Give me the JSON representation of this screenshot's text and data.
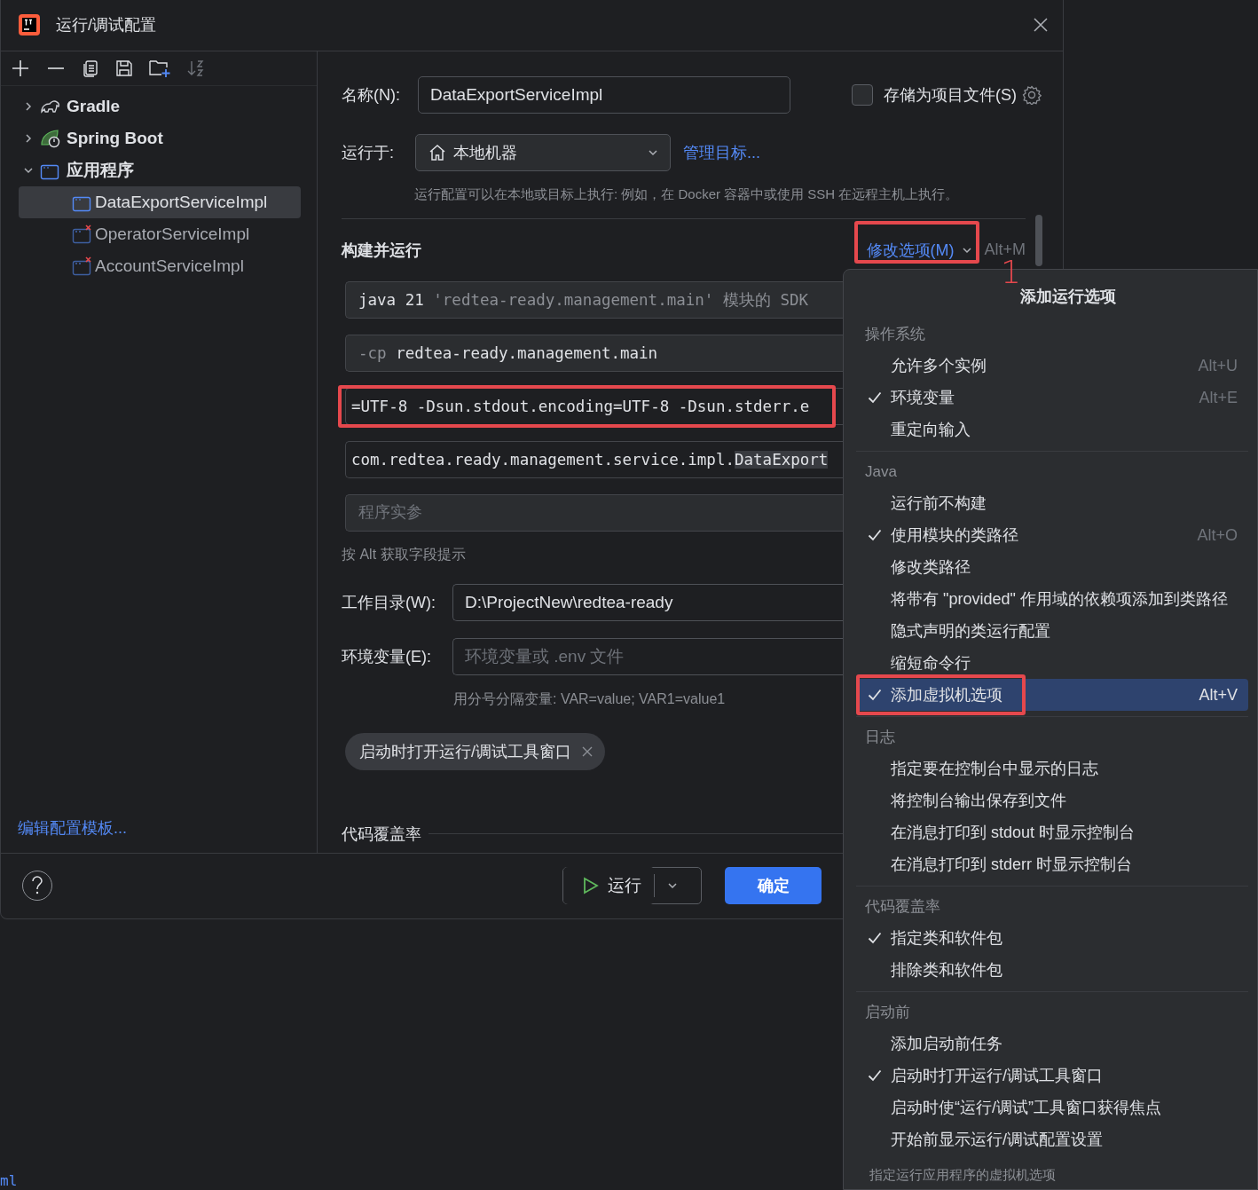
{
  "window": {
    "title": "运行/调试配置"
  },
  "sidebar": {
    "tree": [
      {
        "label": "Gradle",
        "kind": "gradle",
        "expanded": false,
        "selected": false
      },
      {
        "label": "Spring Boot",
        "kind": "spring",
        "expanded": false,
        "selected": false
      },
      {
        "label": "应用程序",
        "kind": "app",
        "expanded": true,
        "selected": false,
        "children": [
          {
            "label": "DataExportServiceImpl",
            "selected": true,
            "error": false
          },
          {
            "label": "OperatorServiceImpl",
            "selected": false,
            "error": true
          },
          {
            "label": "AccountServiceImpl",
            "selected": false,
            "error": true
          }
        ]
      }
    ],
    "template_link": "编辑配置模板..."
  },
  "form": {
    "name_label": "名称(N):",
    "name_value": "DataExportServiceImpl",
    "store_checkbox": {
      "label": "存储为项目文件(S)",
      "checked": false
    },
    "run_on_label": "运行于:",
    "run_on_value": "本地机器",
    "manage_link": "管理目标...",
    "run_on_hint": "运行配置可以在本地或目标上执行: 例如，在 Docker 容器中或使用 SSH 在远程主机上执行。",
    "section_title": "构建并运行",
    "modify_options": {
      "label": "修改选项(M)",
      "shortcut": "Alt+M",
      "annotated": true
    },
    "build_fields": [
      {
        "kind": "sdk",
        "value": "java 21",
        "hint": "'redtea-ready.management.main' 模块的 SDK",
        "annotated": false
      },
      {
        "kind": "classpath",
        "prefix": "-cp",
        "value": "redtea-ready.management.main",
        "annotated": false
      },
      {
        "kind": "vm",
        "value": "=UTF-8 -Dsun.stdout.encoding=UTF-8 -Dsun.stderr.e",
        "annotated": true
      },
      {
        "kind": "main",
        "value": "com.redtea.ready.management.service.impl.",
        "match": "DataExport",
        "annotated": false
      },
      {
        "kind": "args",
        "placeholder": "程序实参",
        "annotated": false
      }
    ],
    "alt_hint": "按 Alt 获取字段提示",
    "workdir_label": "工作目录(W):",
    "workdir_value": "D:\\ProjectNew\\redtea-ready",
    "env_label": "环境变量(E):",
    "env_placeholder": "环境变量或 .env 文件",
    "env_hint": "用分号分隔变量: VAR=value; VAR1=value1",
    "tags": [
      {
        "label": "启动时打开运行/调试工具窗口"
      }
    ],
    "coverage_title": "代码覆盖率"
  },
  "footer": {
    "run_button": "运行",
    "ok_button": "确定"
  },
  "annotation": {
    "label": "1"
  },
  "popup": {
    "title": "添加运行选项",
    "groups": [
      {
        "title": "操作系统",
        "items": [
          {
            "label": "允许多个实例",
            "shortcut": "Alt+U",
            "checked": false,
            "selected": false,
            "annotated": false
          },
          {
            "label": "环境变量",
            "shortcut": "Alt+E",
            "checked": true,
            "selected": false,
            "annotated": false
          },
          {
            "label": "重定向输入",
            "checked": false,
            "selected": false,
            "annotated": false
          }
        ]
      },
      {
        "title": "Java",
        "items": [
          {
            "label": "运行前不构建",
            "checked": false,
            "selected": false,
            "annotated": false
          },
          {
            "label": "使用模块的类路径",
            "shortcut": "Alt+O",
            "checked": true,
            "selected": false,
            "annotated": false
          },
          {
            "label": "修改类路径",
            "checked": false,
            "selected": false,
            "annotated": false
          },
          {
            "label": "将带有 \"provided\" 作用域的依赖项添加到类路径",
            "checked": false,
            "selected": false,
            "annotated": false
          },
          {
            "label": "隐式声明的类运行配置",
            "checked": false,
            "selected": false,
            "annotated": false
          },
          {
            "label": "缩短命令行",
            "checked": false,
            "selected": false,
            "annotated": false
          },
          {
            "label": "添加虚拟机选项",
            "shortcut": "Alt+V",
            "checked": true,
            "selected": true,
            "annotated": true
          }
        ]
      },
      {
        "title": "日志",
        "items": [
          {
            "label": "指定要在控制台中显示的日志",
            "checked": false,
            "selected": false,
            "annotated": false
          },
          {
            "label": "将控制台输出保存到文件",
            "checked": false,
            "selected": false,
            "annotated": false
          },
          {
            "label": "在消息打印到 stdout 时显示控制台",
            "checked": false,
            "selected": false,
            "annotated": false
          },
          {
            "label": "在消息打印到 stderr 时显示控制台",
            "checked": false,
            "selected": false,
            "annotated": false
          }
        ]
      },
      {
        "title": "代码覆盖率",
        "items": [
          {
            "label": "指定类和软件包",
            "checked": true,
            "selected": false,
            "annotated": false
          },
          {
            "label": "排除类和软件包",
            "checked": false,
            "selected": false,
            "annotated": false
          }
        ]
      },
      {
        "title": "启动前",
        "items": [
          {
            "label": "添加启动前任务",
            "checked": false,
            "selected": false,
            "annotated": false
          },
          {
            "label": "启动时打开运行/调试工具窗口",
            "checked": true,
            "selected": false,
            "annotated": false
          },
          {
            "label": "启动时使“运行/调试”工具窗口获得焦点",
            "checked": false,
            "selected": false,
            "annotated": false
          },
          {
            "label": "开始前显示运行/调试配置设置",
            "checked": false,
            "selected": false,
            "annotated": false
          }
        ]
      }
    ],
    "footer_hint": "指定运行应用程序的虚拟机选项"
  },
  "background": {
    "text": "ml"
  }
}
